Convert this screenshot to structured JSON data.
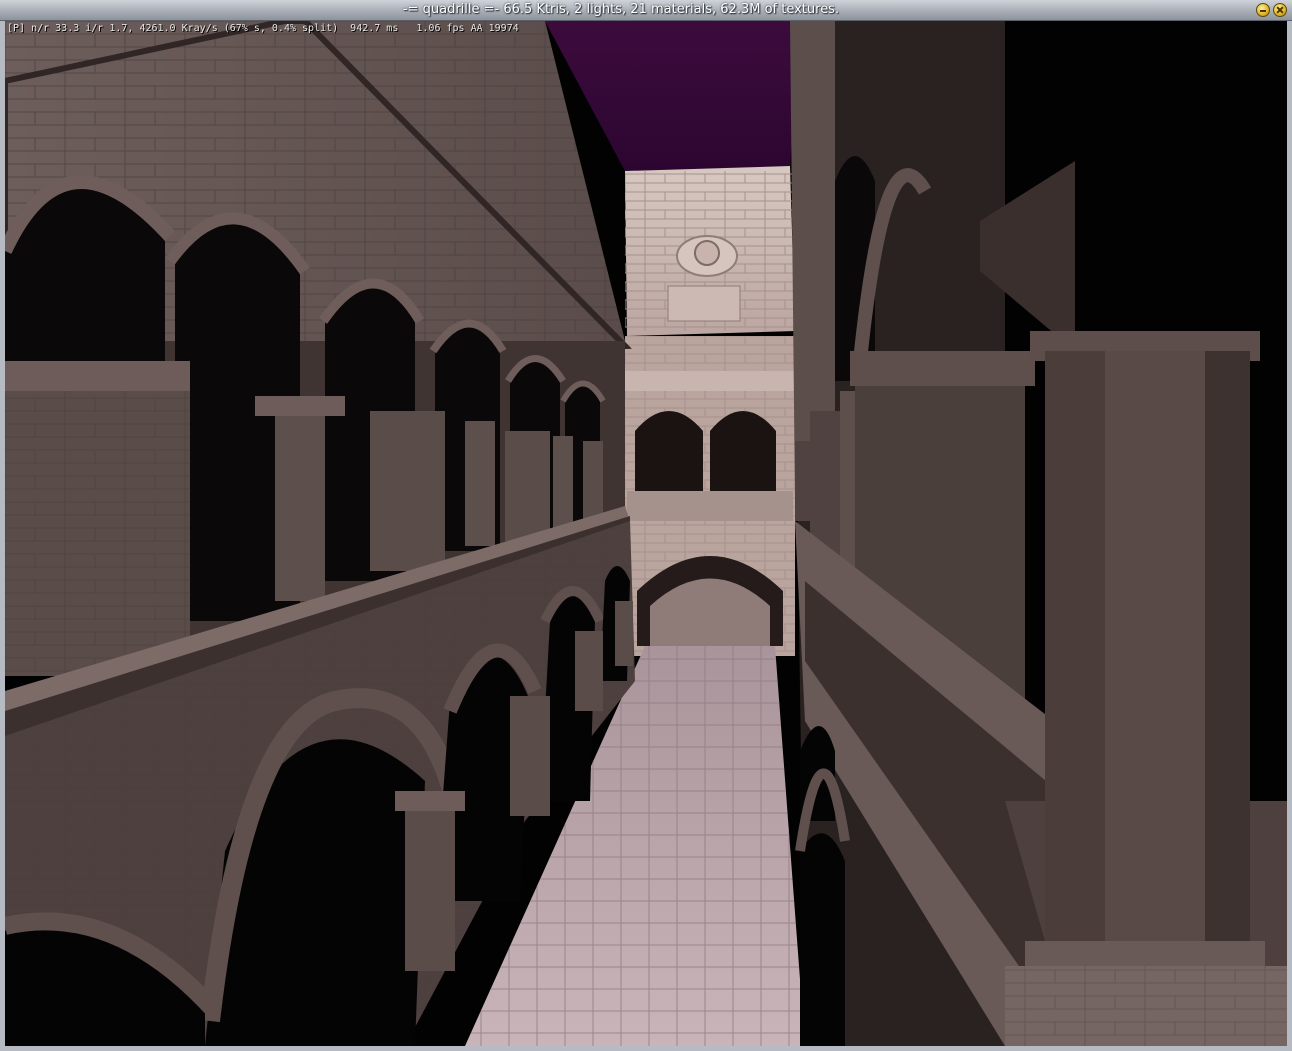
{
  "window": {
    "title": "-= quadrille =-  66.5 Ktris, 2 lights, 21 materials, 62.3M of textures."
  },
  "hud": {
    "text": "[P] n/r 33.3 i/r 1.7, 4261.0 Kray/s (67% s, 0.4% split)  942.7 ms   1.06 fps AA 19974"
  },
  "colors": {
    "sky": "#3a0a3a",
    "stone_dark": "#4e4140",
    "stone_mid": "#6b5b58",
    "stone_light": "#c9b3ad",
    "floor": "#bfa8aa",
    "shadow": "#050404"
  },
  "icons": {
    "minimize": "minimize-icon",
    "close": "close-icon"
  }
}
